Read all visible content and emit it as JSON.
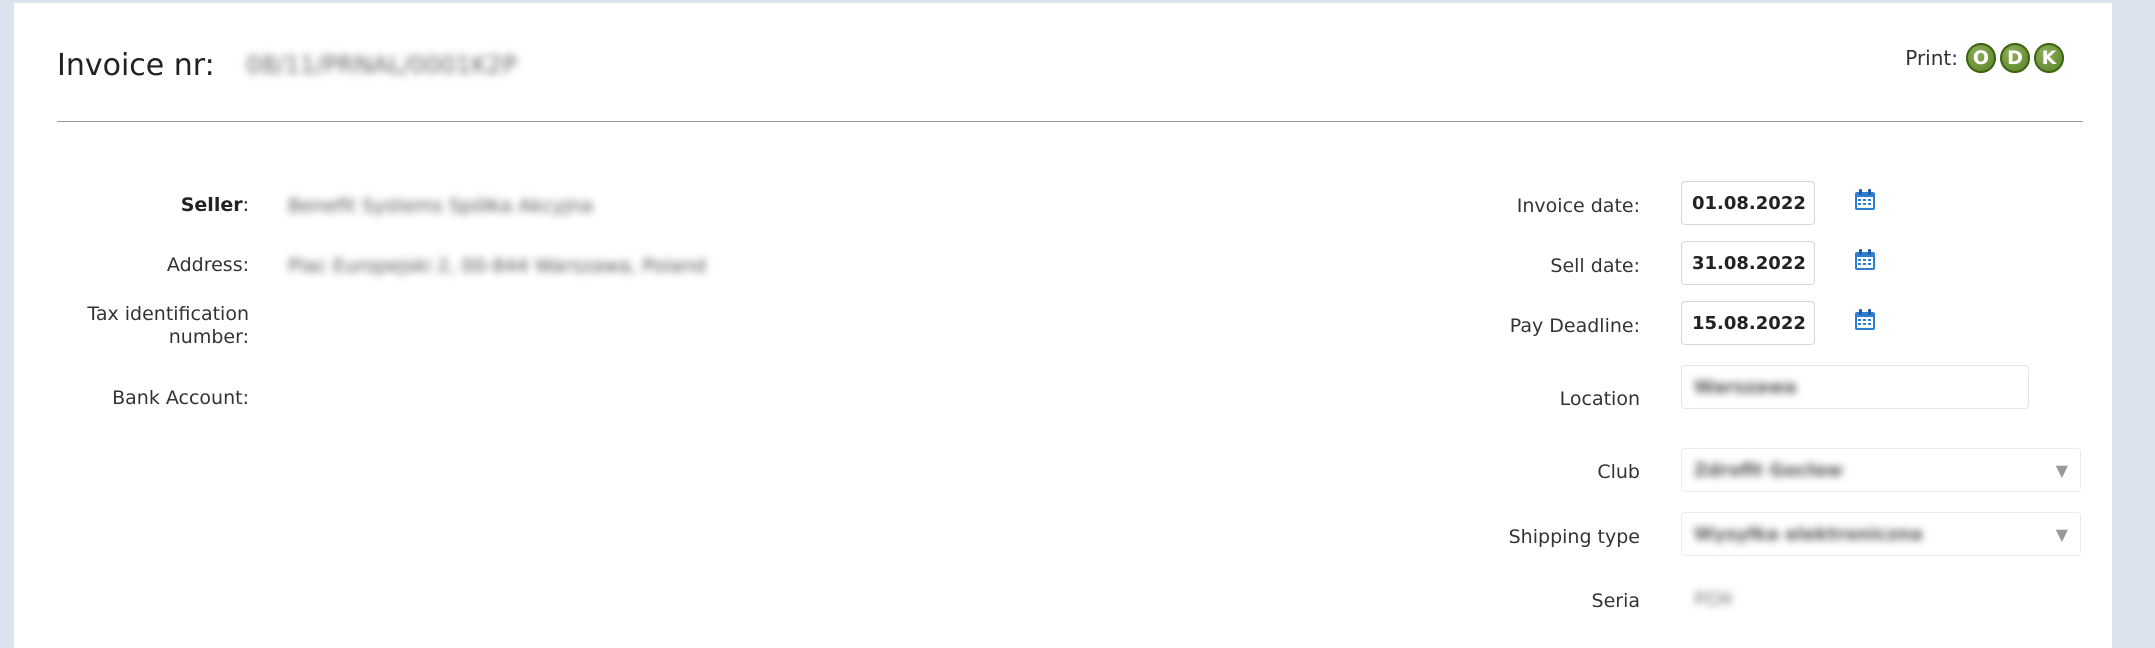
{
  "header": {
    "title": "Invoice nr:",
    "invoice_number": "08/11/PRNAL/0001K2P",
    "print_label": "Print:",
    "print_buttons": [
      "O",
      "D",
      "K"
    ]
  },
  "seller": {
    "seller_label": "Seller",
    "seller_colon": ":",
    "seller_value": "Benefit Systems Spółka Akcyjna",
    "address_label": "Address:",
    "address_value": "Plac Europejski 2, 00-844 Warszawa, Poland",
    "tax_label_line1": "Tax identification",
    "tax_label_line2": "number:",
    "bank_label": "Bank Account:"
  },
  "invoice_fields": {
    "invoice_date_label": "Invoice date:",
    "invoice_date": "01.08.2022",
    "sell_date_label": "Sell date:",
    "sell_date": "31.08.2022",
    "pay_deadline_label": "Pay Deadline:",
    "pay_deadline": "15.08.2022",
    "location_label": "Location",
    "location_value": "Warszawa",
    "club_label": "Club",
    "club_value": "Zdrofit Gocław",
    "shipping_label": "Shipping type",
    "shipping_value": "Wysyłka elektroniczna",
    "seria_label": "Seria",
    "seria_value": "FCH"
  },
  "icons": {
    "calendar": "calendar-icon",
    "chevron": "chevron-down-icon"
  },
  "colors": {
    "print_button": "#5f8a2a",
    "calendar_icon": "#2f7fd1",
    "background": "#dbe4ee"
  }
}
